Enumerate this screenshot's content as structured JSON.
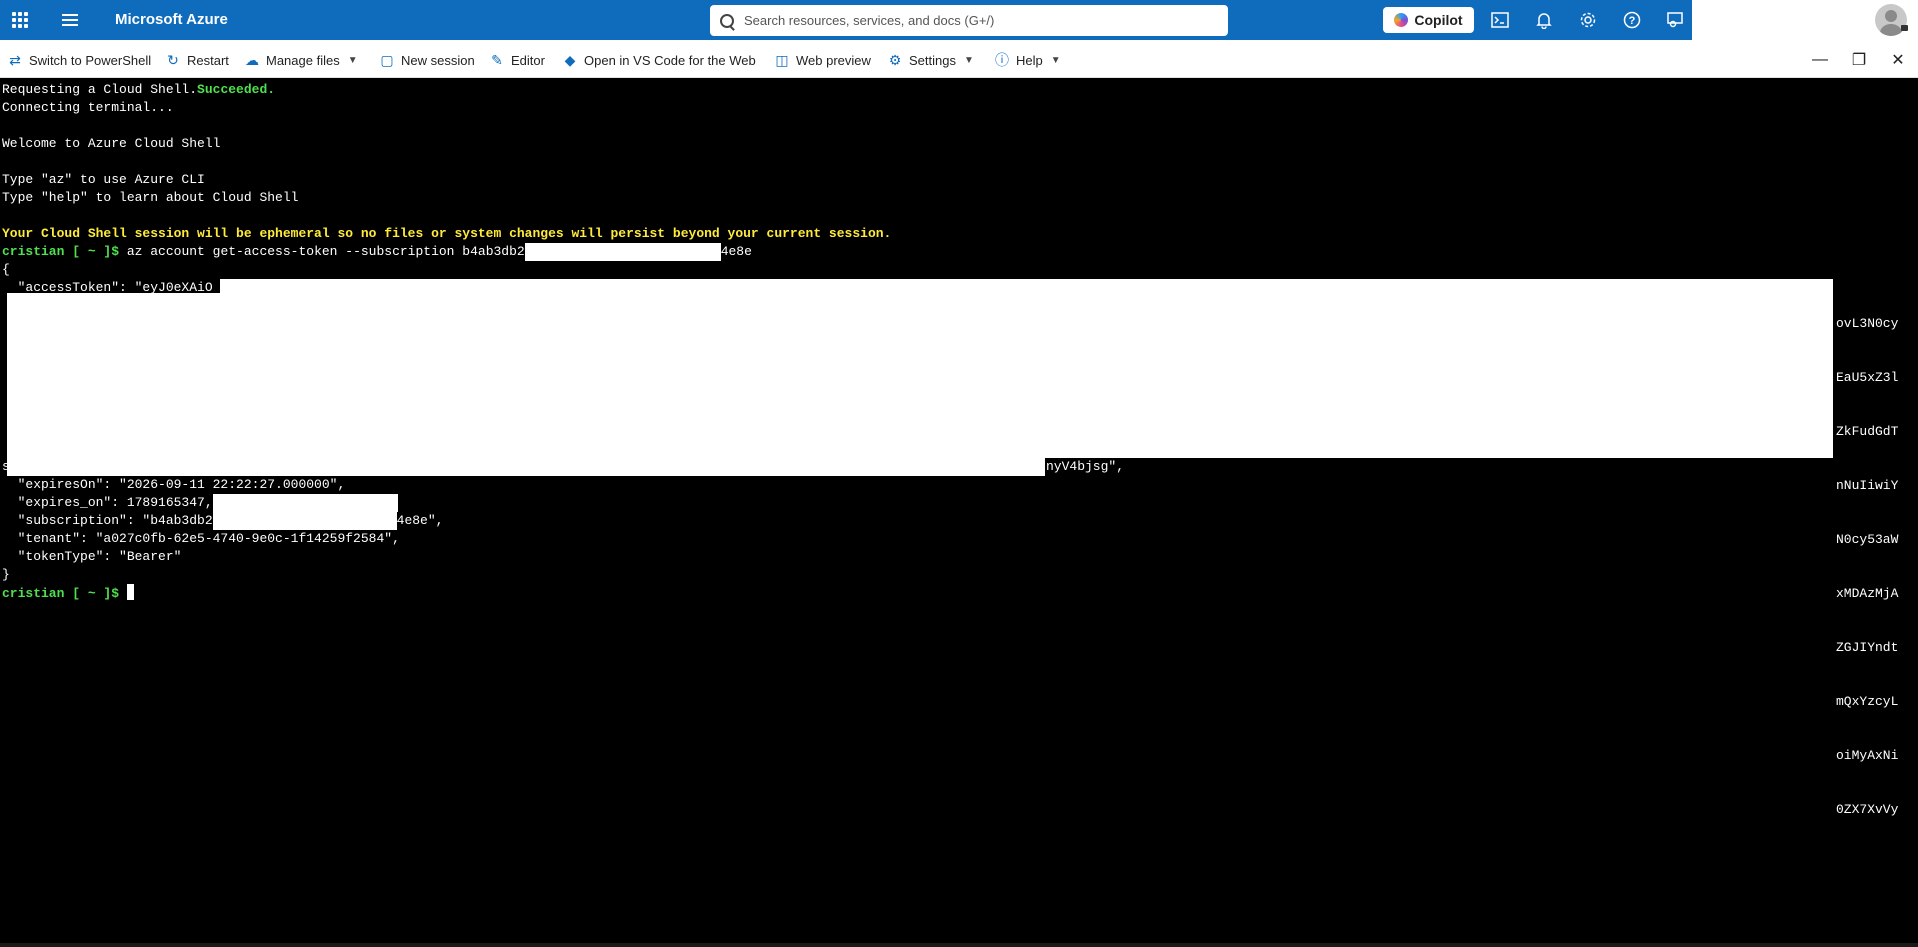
{
  "topbar": {
    "brand": "Microsoft Azure",
    "search_placeholder": "Search resources, services, and docs (G+/)",
    "copilot_label": "Copilot",
    "icons": [
      "waffle-icon",
      "hamburger-icon",
      "cloud-shell-icon",
      "bell-icon",
      "gear-icon",
      "help-icon",
      "feedback-icon"
    ],
    "accent_color": "#0f6cbd"
  },
  "toolbar": {
    "switch": "Switch to PowerShell",
    "restart": "Restart",
    "manage_files": "Manage files",
    "new_session": "New session",
    "editor": "Editor",
    "vscode": "Open in VS Code for the Web",
    "web_preview": "Web preview",
    "settings": "Settings",
    "help": "Help"
  },
  "terminal": {
    "l1a": "Requesting a Cloud Shell.",
    "l1b": "Succeeded.",
    "l2": "Connecting terminal...",
    "l3": "Welcome to Azure Cloud Shell",
    "l4": "Type \"az\" to use Azure CLI",
    "l5": "Type \"help\" to learn about Cloud Shell",
    "warning": "Your Cloud Shell session will be ephemeral so no files or system changes will persist beyond your current session.",
    "prompt": "cristian [ ~ ]$",
    "command_start": " az account get-access-token --subscription b4ab3db2",
    "command_end": "4e8e",
    "open_brace": "{",
    "access_token_start": "  \"accessToken\": \"eyJ0eXAiO",
    "token_right": [
      "ovL3N0cy",
      "EaU5xZ3l",
      "ZkFudGdT",
      "nNuIiwiY",
      "N0cy53aW",
      "xMDAzMjA",
      "ZGJIYndt",
      "mQxYzcyL",
      "oiMyAxNi",
      "0ZX7XvVy"
    ],
    "token_end": "nyV4bjsg\",",
    "token_end_prefix": "s",
    "expires_on": "  \"expiresOn\": \"2026-09-11 22:22:27.000000\",",
    "expires_on_epoch": "  \"expires_on\": 1789165347,",
    "subscription_start": "  \"subscription\": \"b4ab3db2",
    "subscription_end": "4e8e\",",
    "tenant": "  \"tenant\": \"a027c0fb-62e5-4740-9e0c-1f14259f2584\",",
    "token_type": "  \"tokenType\": \"Bearer\"",
    "close_brace": "}",
    "final_prompt": "cristian [ ~ ]$"
  }
}
